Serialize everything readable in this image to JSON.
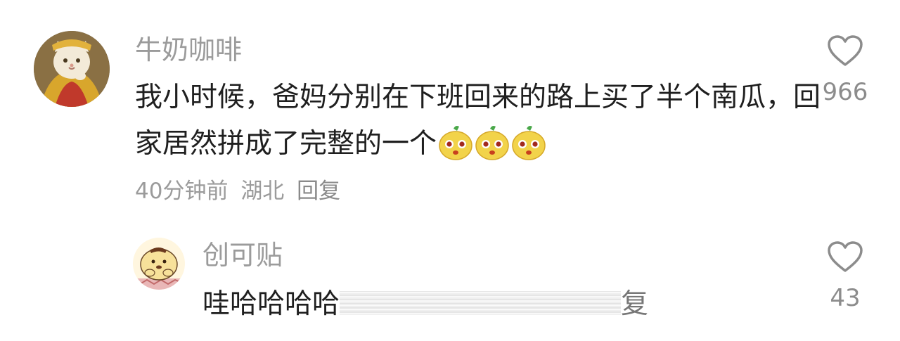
{
  "comments": [
    {
      "username": "牛奶咖啡",
      "text": "我小时候，爸妈分别在下班回来的路上买了半个南瓜，回家居然拼成了完整的一个",
      "emojis": [
        "pumpkin-face-icon",
        "pumpkin-face-icon",
        "pumpkin-face-icon"
      ],
      "time": "40分钟前",
      "location": "湖北",
      "reply_label": "回复",
      "like_count": "966"
    },
    {
      "username": "创可贴",
      "text": "哇哈哈哈哈",
      "text_tail": "复",
      "like_count": "43"
    }
  ],
  "colors": {
    "username": "#9b9b9b",
    "text": "#1f1f1f",
    "meta": "#9b9b9b",
    "icon": "#8c8c8c"
  }
}
